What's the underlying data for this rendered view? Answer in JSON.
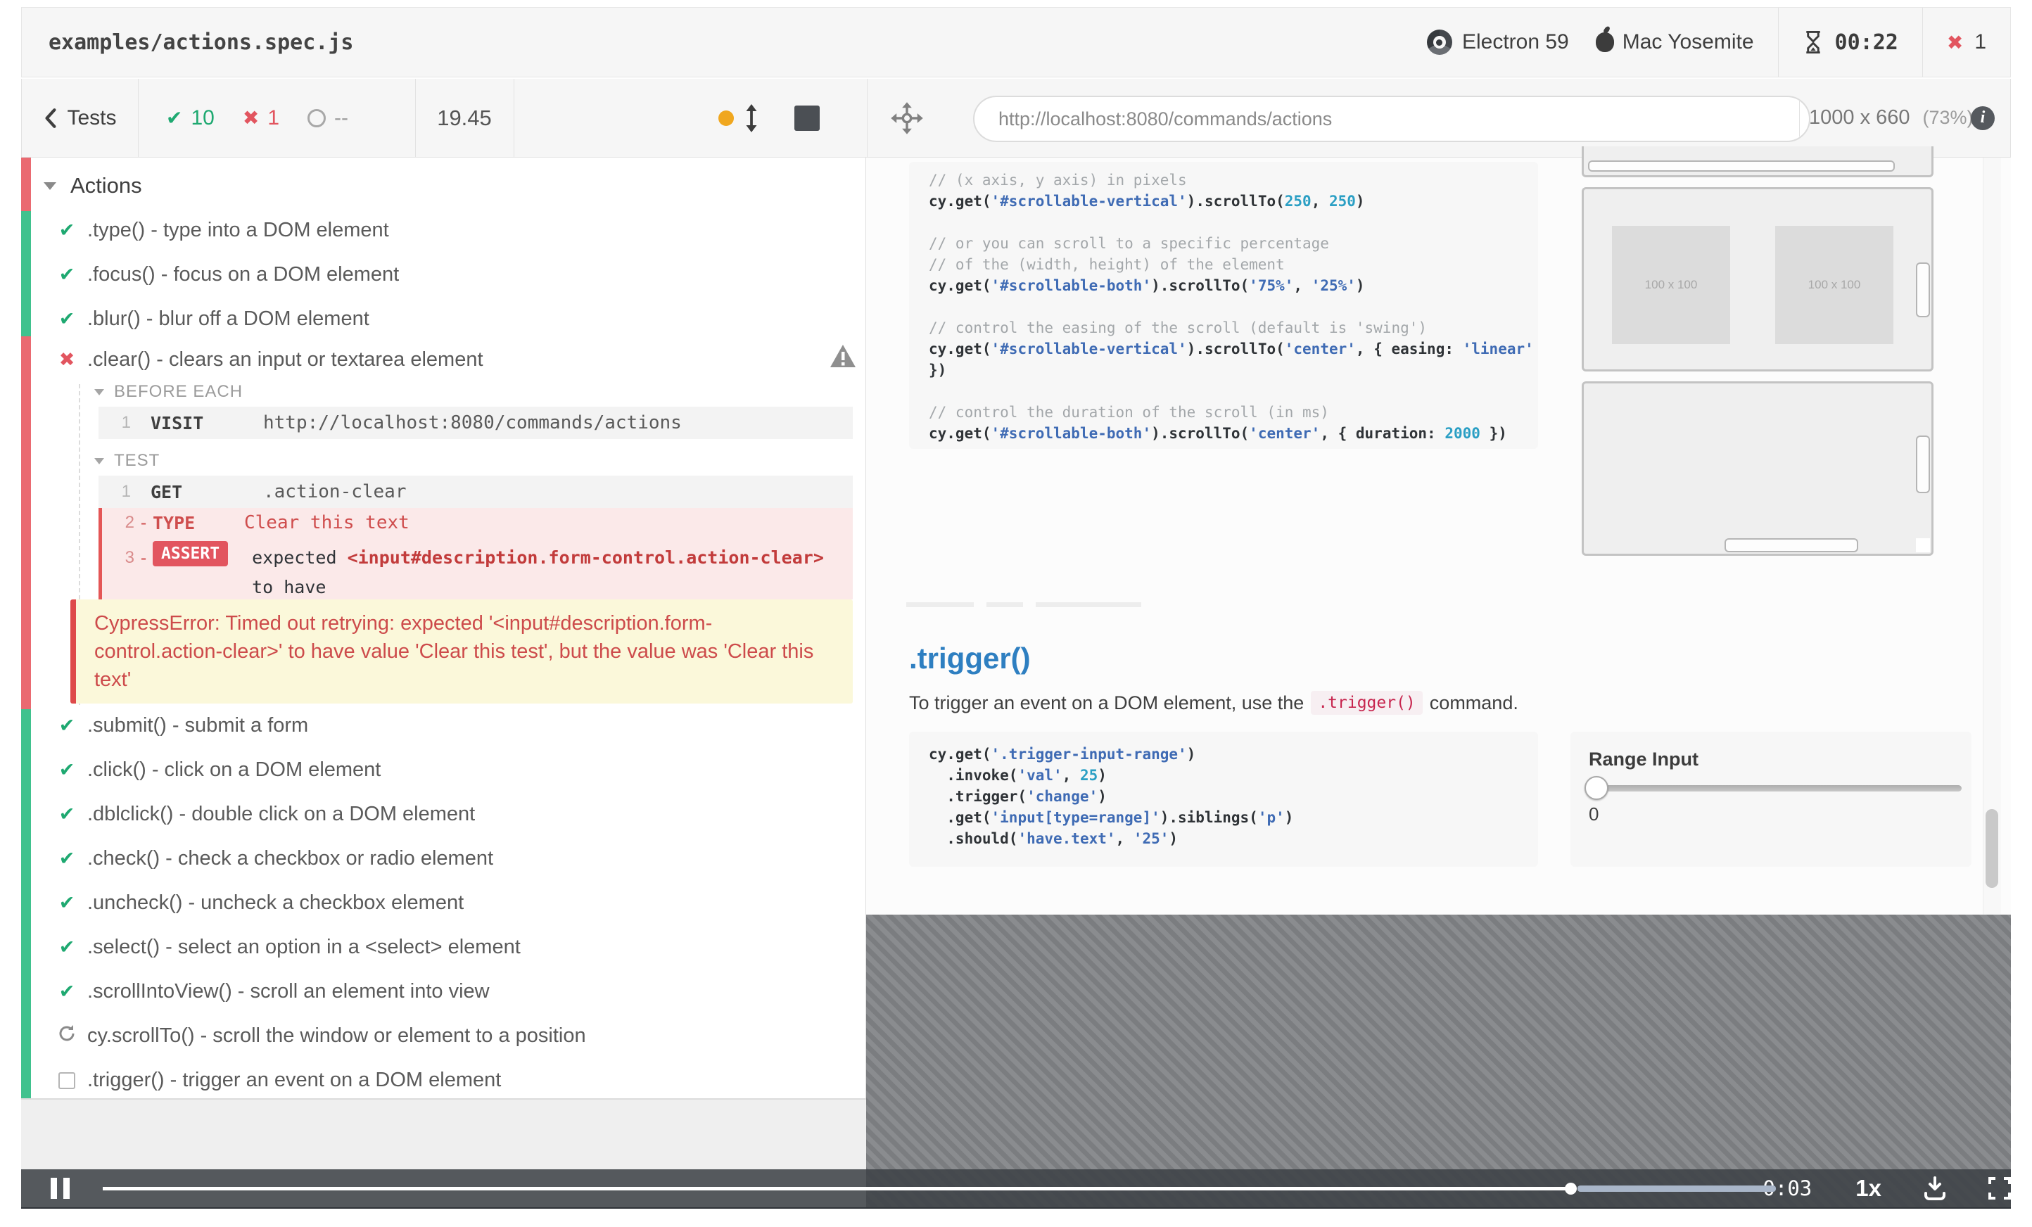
{
  "header": {
    "spec": "examples/actions.spec.js",
    "browser": "Electron 59",
    "os": "Mac Yosemite",
    "timer": "00:22",
    "failure_count": "1"
  },
  "toolbar": {
    "back_label": "Tests",
    "passed": "10",
    "failed": "1",
    "pending": "--",
    "duration": "19.45"
  },
  "aut_header": {
    "url": "http://localhost:8080/commands/actions",
    "viewport": "1000 x 660",
    "zoom": "(73%)"
  },
  "reporter": {
    "suite": "Actions",
    "tests_before": [
      {
        "state": "pass",
        "label": ".type() - type into a DOM element"
      },
      {
        "state": "pass",
        "label": ".focus() - focus on a DOM element"
      },
      {
        "state": "pass",
        "label": ".blur() - blur off a DOM element"
      }
    ],
    "failed_test": {
      "label": ".clear() - clears an input or textarea element"
    },
    "hooks": {
      "before_title": "BEFORE EACH",
      "test_title": "TEST",
      "visit_row": {
        "n": "1",
        "cmd": "VISIT",
        "msg": "http://localhost:8080/commands/actions"
      },
      "get_row": {
        "n": "1",
        "cmd": "GET",
        "msg": ".action-clear"
      },
      "type_row": {
        "n": "2",
        "dash": "-",
        "cmd": "TYPE",
        "msg": "Clear this text"
      },
      "assert_row": {
        "n": "3",
        "dash": "-",
        "badge": "ASSERT",
        "line1": [
          [
            "",
            "expected  "
          ],
          [
            "b",
            "<input#description.form-control.action-clear>"
          ],
          [
            "",
            " to have"
          ]
        ],
        "line2": [
          [
            "",
            "value "
          ],
          [
            "b",
            "Clear this test"
          ],
          [
            "",
            " , but the value was "
          ],
          [
            "b",
            "Clear this text"
          ]
        ]
      }
    },
    "error": "CypressError: Timed out retrying: expected '<input#description.form-control.action-clear>' to have value 'Clear this test', but the value was 'Clear this text'",
    "tests_after": [
      {
        "state": "pass",
        "label": ".submit() - submit a form"
      },
      {
        "state": "pass",
        "label": ".click() - click on a DOM element"
      },
      {
        "state": "pass",
        "label": ".dblclick() - double click on a DOM element"
      },
      {
        "state": "pass",
        "label": ".check() - check a checkbox or radio element"
      },
      {
        "state": "pass",
        "label": ".uncheck() - uncheck a checkbox element"
      },
      {
        "state": "pass",
        "label": ".select() - select an option in a <select> element"
      },
      {
        "state": "pass",
        "label": ".scrollIntoView() - scroll an element into view"
      },
      {
        "state": "running",
        "label": "cy.scrollTo() - scroll the window or element to a position"
      },
      {
        "state": "pending",
        "label": ".trigger() - trigger an event on a DOM element"
      }
    ]
  },
  "aut_page": {
    "code1": [
      [
        [
          "c",
          "// (x axis, y axis) in pixels"
        ]
      ],
      [
        [
          "",
          "cy.get("
        ],
        [
          "s",
          "'#scrollable-vertical'"
        ],
        [
          "",
          ").scrollTo("
        ],
        [
          "n",
          "250"
        ],
        [
          "",
          ", "
        ],
        [
          "n",
          "250"
        ],
        [
          "",
          ")"
        ]
      ],
      [],
      [
        [
          "c",
          "// or you can scroll to a specific percentage"
        ]
      ],
      [
        [
          "c",
          "// of the (width, height) of the element"
        ]
      ],
      [
        [
          "",
          "cy.get("
        ],
        [
          "s",
          "'#scrollable-both'"
        ],
        [
          "",
          ").scrollTo("
        ],
        [
          "s",
          "'75%'"
        ],
        [
          "",
          ", "
        ],
        [
          "s",
          "'25%'"
        ],
        [
          "",
          ")"
        ]
      ],
      [],
      [
        [
          "c",
          "// control the easing of the scroll (default is 'swing')"
        ]
      ],
      [
        [
          "",
          "cy.get("
        ],
        [
          "s",
          "'#scrollable-vertical'"
        ],
        [
          "",
          ").scrollTo("
        ],
        [
          "s",
          "'center'"
        ],
        [
          "",
          ", { easing: "
        ],
        [
          "s",
          "'linear'"
        ]
      ],
      [
        [
          "",
          "})"
        ]
      ],
      [],
      [
        [
          "c",
          "// control the duration of the scroll (in ms)"
        ]
      ],
      [
        [
          "",
          "cy.get("
        ],
        [
          "s",
          "'#scrollable-both'"
        ],
        [
          "",
          ").scrollTo("
        ],
        [
          "s",
          "'center'"
        ],
        [
          "",
          ", { duration: "
        ],
        [
          "n",
          "2000"
        ],
        [
          "",
          " })"
        ]
      ]
    ],
    "trigger_heading": ".trigger()",
    "trigger_para_before": "To trigger an event on a DOM element, use the",
    "trigger_para_code": ".trigger()",
    "trigger_para_after": "command.",
    "code2": [
      [
        [
          "",
          "cy.get("
        ],
        [
          "s",
          "'.trigger-input-range'"
        ],
        [
          "",
          ")"
        ]
      ],
      [
        [
          "",
          "  .invoke("
        ],
        [
          "s",
          "'val'"
        ],
        [
          "",
          ", "
        ],
        [
          "n",
          "25"
        ],
        [
          "",
          ")"
        ]
      ],
      [
        [
          "",
          "  .trigger("
        ],
        [
          "s",
          "'change'"
        ],
        [
          "",
          ")"
        ]
      ],
      [
        [
          "",
          "  .get("
        ],
        [
          "s",
          "'input[type=range]'"
        ],
        [
          "",
          ").siblings("
        ],
        [
          "s",
          "'p'"
        ],
        [
          "",
          ")"
        ]
      ],
      [
        [
          "",
          "  .should("
        ],
        [
          "s",
          "'have.text'"
        ],
        [
          "",
          ", "
        ],
        [
          "s",
          "'25'"
        ],
        [
          "",
          ")"
        ]
      ]
    ],
    "placeholder_label": "100 x 100",
    "range": {
      "label": "Range Input",
      "value": "0"
    }
  },
  "player": {
    "time_left": "-0:03",
    "speed": "1x"
  },
  "colors": {
    "pass_green": "#1fa971",
    "fail_red": "#e2555f",
    "strip_green": "#40c28e",
    "strip_red": "#ea6a71",
    "error_bg": "#fbf8da",
    "accent_blue": "#2e7fc1",
    "pending_orange": "#f0a71f"
  },
  "icons": {
    "pass": "✔",
    "fail": "✖"
  }
}
